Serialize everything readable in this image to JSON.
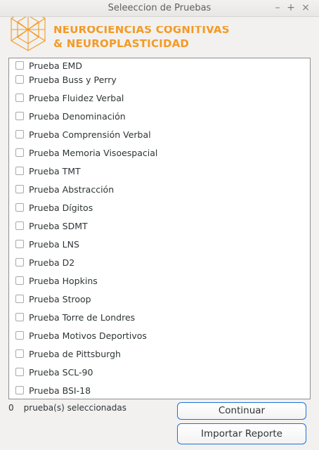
{
  "window": {
    "title": "Seleeccion de Pruebas",
    "minimize": "–",
    "maximize": "+",
    "close": "×"
  },
  "logo": {
    "line1": "NEUROCIENCIAS COGNITIVAS",
    "line2": "& NEUROPLASTICIDAD",
    "color": "#f39a26"
  },
  "tests": [
    {
      "label": "Prueba EMD",
      "checked": false
    },
    {
      "label": "Prueba Buss y Perry",
      "checked": false
    },
    {
      "label": "Prueba Fluidez Verbal",
      "checked": false
    },
    {
      "label": "Prueba Denominación",
      "checked": false
    },
    {
      "label": "Prueba Comprensión Verbal",
      "checked": false
    },
    {
      "label": "Prueba Memoria Visoespacial",
      "checked": false
    },
    {
      "label": "Prueba TMT",
      "checked": false
    },
    {
      "label": "Prueba Abstracción",
      "checked": false
    },
    {
      "label": "Prueba Dígitos",
      "checked": false
    },
    {
      "label": "Prueba SDMT",
      "checked": false
    },
    {
      "label": "Prueba LNS",
      "checked": false
    },
    {
      "label": "Prueba D2",
      "checked": false
    },
    {
      "label": "Prueba Hopkins",
      "checked": false
    },
    {
      "label": "Prueba Stroop",
      "checked": false
    },
    {
      "label": "Prueba Torre de Londres",
      "checked": false
    },
    {
      "label": "Prueba Motivos Deportivos",
      "checked": false
    },
    {
      "label": "Prueba de Pittsburgh",
      "checked": false
    },
    {
      "label": "Prueba SCL-90",
      "checked": false
    },
    {
      "label": "Prueba BSI-18",
      "checked": false
    }
  ],
  "selection": {
    "count": "0",
    "label": "prueba(s) seleccionadas"
  },
  "buttons": {
    "continue": "Continuar",
    "import": "Importar Reporte"
  }
}
